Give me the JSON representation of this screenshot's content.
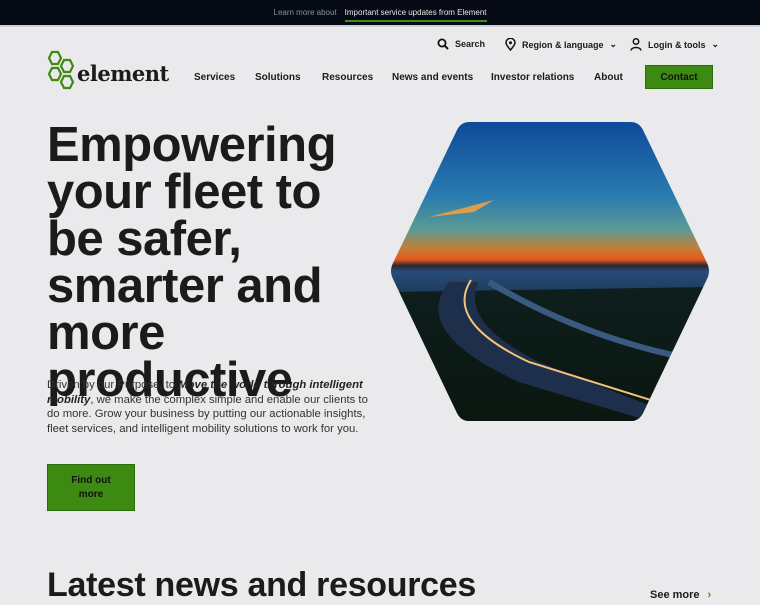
{
  "announcement": {
    "prefix": "Learn more about",
    "link": "Important service updates from Element"
  },
  "utility": {
    "search": "Search",
    "region": "Region & language",
    "login": "Login & tools"
  },
  "logo": {
    "text": "element"
  },
  "nav": {
    "items": [
      {
        "label": "Services"
      },
      {
        "label": "Solutions"
      },
      {
        "label": "Resources"
      },
      {
        "label": "News and events"
      },
      {
        "label": "Investor relations"
      },
      {
        "label": "About"
      }
    ],
    "contact": "Contact"
  },
  "hero": {
    "title": "Empowering your fleet to be safer, smarter and more productive",
    "intro_before": "Driven by our Purpose, to ",
    "intro_purpose": "Move the world through intelligent mobility",
    "intro_after": ", we make the complex simple and enable our clients to do more. Grow your business by putting our actionable insights, fleet services, and intelligent mobility solutions to work for you.",
    "cta": "Find out more"
  },
  "news": {
    "title": "Latest news and resources",
    "see_more": "See more"
  },
  "colors": {
    "brand_green": "#3d8a12",
    "topbar": "#050a14",
    "background": "#eaeaec"
  }
}
